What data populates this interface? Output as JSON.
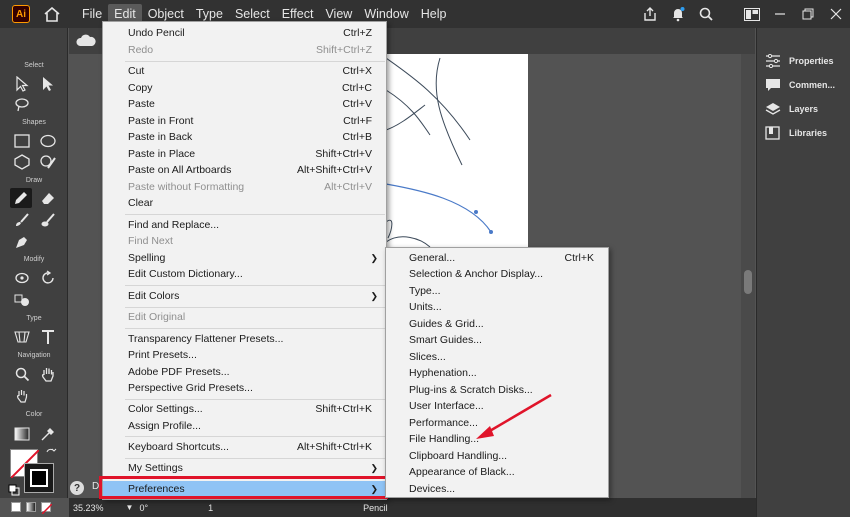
{
  "app": {
    "logo": "Ai"
  },
  "menubar": {
    "items": [
      "File",
      "Edit",
      "Object",
      "Type",
      "Select",
      "Effect",
      "View",
      "Window",
      "Help"
    ],
    "active": "Edit"
  },
  "toolbar": {
    "sections": [
      "Select",
      "Shapes",
      "Draw",
      "Modify",
      "Type",
      "Navigation",
      "Color"
    ]
  },
  "right_panel": {
    "items": [
      "Properties",
      "Commen...",
      "Layers",
      "Libraries"
    ]
  },
  "status": {
    "zoom": "35.23%",
    "rotation": "0°",
    "artboard": "1",
    "tool": "Pencil",
    "doc_tab": "D"
  },
  "edit_menu": {
    "undo": {
      "label": "Undo Pencil",
      "shortcut": "Ctrl+Z"
    },
    "redo": {
      "label": "Redo",
      "shortcut": "Shift+Ctrl+Z"
    },
    "cut": {
      "label": "Cut",
      "shortcut": "Ctrl+X"
    },
    "copy": {
      "label": "Copy",
      "shortcut": "Ctrl+C"
    },
    "paste": {
      "label": "Paste",
      "shortcut": "Ctrl+V"
    },
    "paste_front": {
      "label": "Paste in Front",
      "shortcut": "Ctrl+F"
    },
    "paste_back": {
      "label": "Paste in Back",
      "shortcut": "Ctrl+B"
    },
    "paste_place": {
      "label": "Paste in Place",
      "shortcut": "Shift+Ctrl+V"
    },
    "paste_all": {
      "label": "Paste on All Artboards",
      "shortcut": "Alt+Shift+Ctrl+V"
    },
    "paste_noformat": {
      "label": "Paste without Formatting",
      "shortcut": "Alt+Ctrl+V"
    },
    "clear": {
      "label": "Clear"
    },
    "find_replace": {
      "label": "Find and Replace..."
    },
    "find_next": {
      "label": "Find Next"
    },
    "spelling": {
      "label": "Spelling"
    },
    "edit_dict": {
      "label": "Edit Custom Dictionary..."
    },
    "edit_colors": {
      "label": "Edit Colors"
    },
    "edit_original": {
      "label": "Edit Original"
    },
    "transparency": {
      "label": "Transparency Flattener Presets..."
    },
    "print_presets": {
      "label": "Print Presets..."
    },
    "pdf_presets": {
      "label": "Adobe PDF Presets..."
    },
    "perspective": {
      "label": "Perspective Grid Presets..."
    },
    "color_settings": {
      "label": "Color Settings...",
      "shortcut": "Shift+Ctrl+K"
    },
    "assign_profile": {
      "label": "Assign Profile..."
    },
    "keyboard": {
      "label": "Keyboard Shortcuts...",
      "shortcut": "Alt+Shift+Ctrl+K"
    },
    "my_settings": {
      "label": "My Settings"
    },
    "preferences": {
      "label": "Preferences"
    }
  },
  "preferences_submenu": {
    "general": {
      "label": "General...",
      "shortcut": "Ctrl+K"
    },
    "selection": {
      "label": "Selection & Anchor Display..."
    },
    "type": {
      "label": "Type..."
    },
    "units": {
      "label": "Units..."
    },
    "guides": {
      "label": "Guides & Grid..."
    },
    "smart": {
      "label": "Smart Guides..."
    },
    "slices": {
      "label": "Slices..."
    },
    "hyphenation": {
      "label": "Hyphenation..."
    },
    "plugins": {
      "label": "Plug-ins & Scratch Disks..."
    },
    "ui": {
      "label": "User Interface..."
    },
    "performance": {
      "label": "Performance..."
    },
    "file_handling": {
      "label": "File Handling..."
    },
    "clipboard": {
      "label": "Clipboard Handling..."
    },
    "black": {
      "label": "Appearance of Black..."
    },
    "devices": {
      "label": "Devices..."
    }
  },
  "colors": {
    "highlight": "#8fc3f5",
    "annotation": "#e0142a",
    "menu_bg": "#f2f2f2",
    "dark_bg": "#323232"
  }
}
